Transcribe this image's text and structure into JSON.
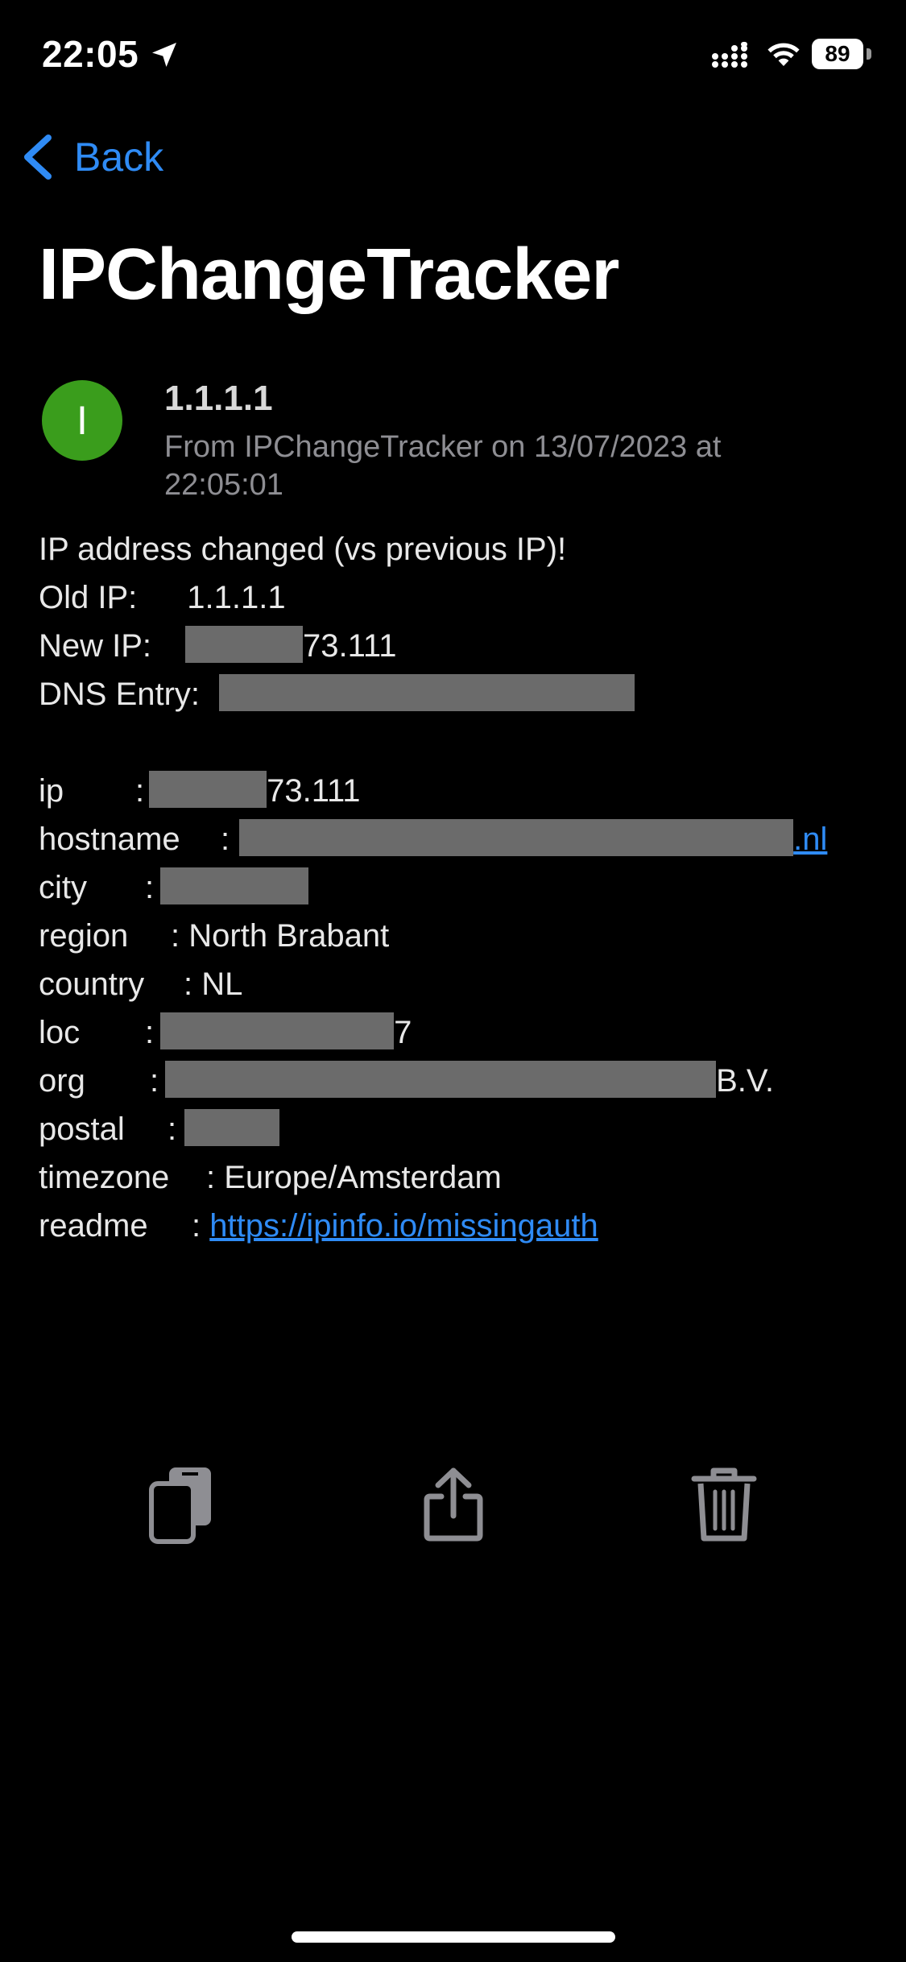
{
  "status_bar": {
    "time": "22:05",
    "battery": "89",
    "icons": [
      "location-arrow-icon",
      "cellular-signal-icon",
      "wifi-icon",
      "battery-icon"
    ]
  },
  "nav": {
    "back_label": "Back",
    "title": "IPChangeTracker"
  },
  "message": {
    "avatar_letter": "I",
    "avatar_color": "#3a9d1c",
    "subject": "1.1.1.1",
    "sender_line": "From IPChangeTracker on 13/07/2023 at 22:05:01"
  },
  "body": {
    "headline": "IP address changed (vs previous IP)!",
    "old_ip_label": "Old IP:",
    "old_ip_value": "1.1.1.1",
    "new_ip_label": "New IP:",
    "new_ip_suffix": "73.111",
    "dns_label": "DNS Entry:",
    "ip_label": "ip",
    "ip_suffix": "73.111",
    "hostname_label": "hostname",
    "hostname_suffix": ".nl",
    "city_label": "city",
    "region_label": "region",
    "region_value": "North Brabant",
    "country_label": "country",
    "country_value": "NL",
    "loc_label": "loc",
    "loc_suffix": "7",
    "org_label": "org",
    "org_suffix": "B.V.",
    "postal_label": "postal",
    "timezone_label": "timezone",
    "timezone_value": "Europe/Amsterdam",
    "readme_label": "readme",
    "readme_link": "https://ipinfo.io/missingauth",
    "separator": ":"
  },
  "toolbar": {
    "icons": [
      "copy-icon",
      "share-icon",
      "trash-icon"
    ]
  },
  "colors": {
    "accent": "#2f8bf5",
    "background": "#000000",
    "redaction": "#6b6b6b"
  }
}
